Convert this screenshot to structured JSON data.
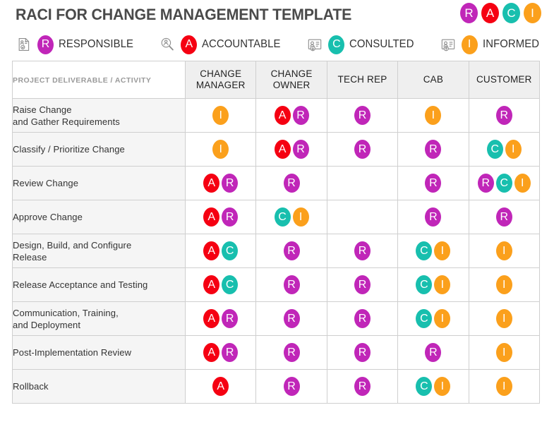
{
  "header": {
    "title": "RACI FOR CHANGE MANAGEMENT TEMPLATE",
    "logo_badges": [
      {
        "letter": "R",
        "color": "#C026B8"
      },
      {
        "letter": "A",
        "color": "#F50012"
      },
      {
        "letter": "C",
        "color": "#18BFAE"
      },
      {
        "letter": "I",
        "color": "#FBA01C"
      }
    ]
  },
  "legend": [
    {
      "letter": "R",
      "label": "RESPONSIBLE",
      "color": "#C026B8",
      "icon": "document-person-check-icon"
    },
    {
      "letter": "A",
      "label": "ACCOUNTABLE",
      "color": "#F50012",
      "icon": "magnifier-person-icon"
    },
    {
      "letter": "C",
      "label": "CONSULTED",
      "color": "#18BFAE",
      "icon": "id-card-down-arrow-icon"
    },
    {
      "letter": "I",
      "label": "INFORMED",
      "color": "#FBA01C",
      "icon": "id-card-up-arrow-icon"
    }
  ],
  "table": {
    "activity_header": "PROJECT DELIVERABLE / ACTIVITY",
    "roles": [
      {
        "line1": "CHANGE",
        "line2": "MANAGER"
      },
      {
        "line1": "CHANGE",
        "line2": "OWNER"
      },
      {
        "line1": "TECH REP",
        "line2": ""
      },
      {
        "line1": "CAB",
        "line2": ""
      },
      {
        "line1": "CUSTOMER",
        "line2": ""
      }
    ],
    "rows": [
      {
        "activity_line1": "Raise Change",
        "activity_line2": "and Gather Requirements",
        "cells": [
          [
            "I"
          ],
          [
            "A",
            "R"
          ],
          [
            "R"
          ],
          [
            "I"
          ],
          [
            "R"
          ]
        ]
      },
      {
        "activity_line1": "Classify / Prioritize Change",
        "activity_line2": "",
        "cells": [
          [
            "I"
          ],
          [
            "A",
            "R"
          ],
          [
            "R"
          ],
          [
            "R"
          ],
          [
            "C",
            "I"
          ]
        ]
      },
      {
        "activity_line1": "Review Change",
        "activity_line2": "",
        "cells": [
          [
            "A",
            "R"
          ],
          [
            "R"
          ],
          [],
          [
            "R"
          ],
          [
            "R",
            "C",
            "I"
          ]
        ]
      },
      {
        "activity_line1": "Approve Change",
        "activity_line2": "",
        "cells": [
          [
            "A",
            "R"
          ],
          [
            "C",
            "I"
          ],
          [],
          [
            "R"
          ],
          [
            "R"
          ]
        ]
      },
      {
        "activity_line1": "Design, Build, and Configure",
        "activity_line2": "Release",
        "cells": [
          [
            "A",
            "C"
          ],
          [
            "R"
          ],
          [
            "R"
          ],
          [
            "C",
            "I"
          ],
          [
            "I"
          ]
        ]
      },
      {
        "activity_line1": "Release Acceptance and Testing",
        "activity_line2": "",
        "cells": [
          [
            "A",
            "C"
          ],
          [
            "R"
          ],
          [
            "R"
          ],
          [
            "C",
            "I"
          ],
          [
            "I"
          ]
        ]
      },
      {
        "activity_line1": "Communication, Training,",
        "activity_line2": "and Deployment",
        "cells": [
          [
            "A",
            "R"
          ],
          [
            "R"
          ],
          [
            "R"
          ],
          [
            "C",
            "I"
          ],
          [
            "I"
          ]
        ]
      },
      {
        "activity_line1": "Post-Implementation Review",
        "activity_line2": "",
        "cells": [
          [
            "A",
            "R"
          ],
          [
            "R"
          ],
          [
            "R"
          ],
          [
            "R"
          ],
          [
            "I"
          ]
        ]
      },
      {
        "activity_line1": "Rollback",
        "activity_line2": "",
        "cells": [
          [
            "A"
          ],
          [
            "R"
          ],
          [
            "R"
          ],
          [
            "C",
            "I"
          ],
          [
            "I"
          ]
        ]
      }
    ]
  },
  "colors": {
    "responsible": "#C026B8",
    "accountable": "#F50012",
    "consulted": "#18BFAE",
    "informed": "#FBA01C",
    "title_gray": "#4a4a4a",
    "header_fill": "#efefef",
    "activity_fill": "#f5f5f5",
    "grid_line": "#cfcfcf"
  }
}
